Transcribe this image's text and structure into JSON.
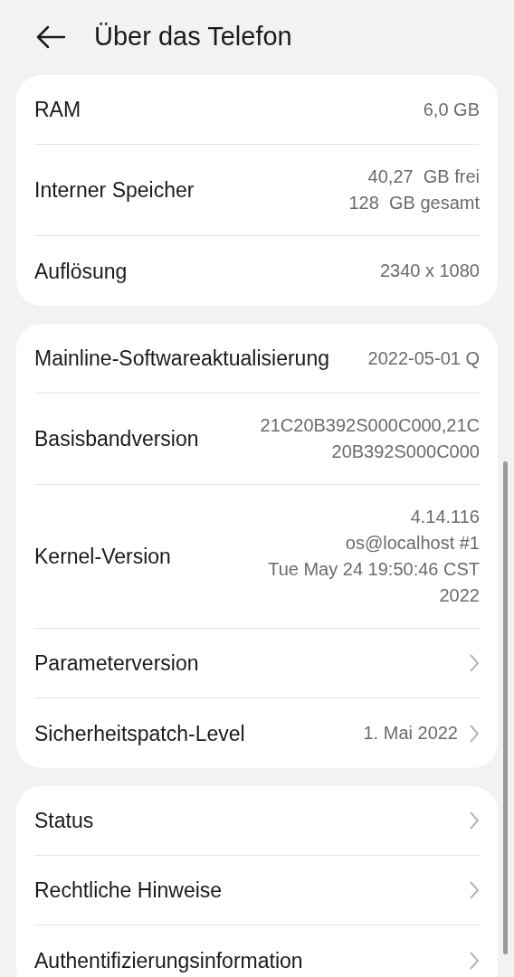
{
  "header": {
    "title": "Über das Telefon"
  },
  "groups": [
    {
      "rows": [
        {
          "kind": "info",
          "label": "RAM",
          "value": [
            "6,0 GB"
          ]
        },
        {
          "kind": "info",
          "label": "Interner Speicher",
          "value": [
            "40,27  GB frei",
            "128  GB gesamt"
          ]
        },
        {
          "kind": "info",
          "label": "Auflösung",
          "value": [
            "2340 x 1080"
          ]
        }
      ]
    },
    {
      "rows": [
        {
          "kind": "info",
          "label": "Mainline-Softwareaktualisierung",
          "value": [
            "2022-05-01 Q"
          ]
        },
        {
          "kind": "info",
          "label": "Basisbandversion",
          "value": [
            "21C20B392S000C000,21C",
            "20B392S000C000"
          ]
        },
        {
          "kind": "info",
          "label": "Kernel-Version",
          "value": [
            "4.14.116",
            "os@localhost #1",
            "Tue May 24 19:50:46 CST",
            "2022"
          ]
        },
        {
          "kind": "link",
          "label": "Parameterversion",
          "value": []
        },
        {
          "kind": "link",
          "label": "Sicherheitspatch-Level",
          "value": [
            "1. Mai 2022"
          ]
        }
      ]
    },
    {
      "rows": [
        {
          "kind": "link",
          "label": "Status",
          "value": []
        },
        {
          "kind": "link",
          "label": "Rechtliche Hinweise",
          "value": []
        },
        {
          "kind": "link",
          "label": "Authentifizierungsinformation",
          "value": []
        }
      ]
    }
  ]
}
